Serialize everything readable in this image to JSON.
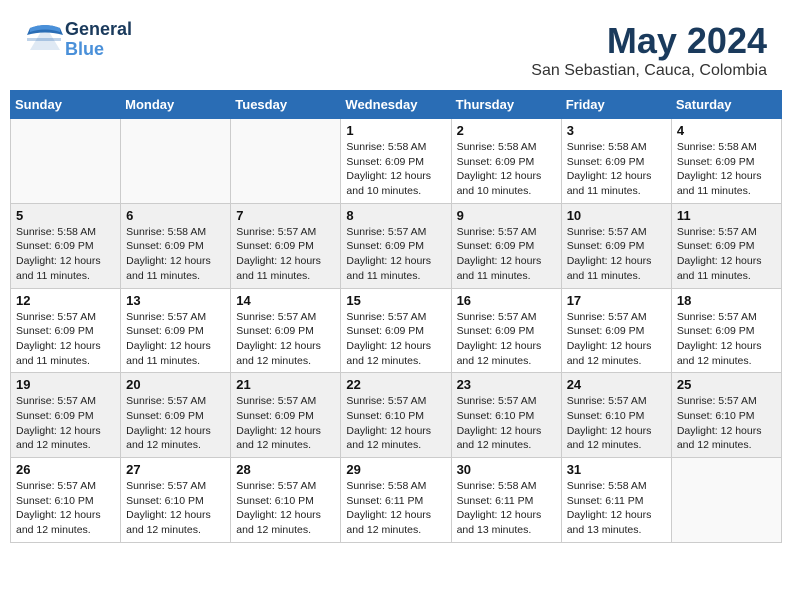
{
  "header": {
    "logo_line1": "General",
    "logo_line2": "Blue",
    "month_year": "May 2024",
    "location": "San Sebastian, Cauca, Colombia"
  },
  "days_of_week": [
    "Sunday",
    "Monday",
    "Tuesday",
    "Wednesday",
    "Thursday",
    "Friday",
    "Saturday"
  ],
  "weeks": [
    [
      {
        "day": "",
        "info": ""
      },
      {
        "day": "",
        "info": ""
      },
      {
        "day": "",
        "info": ""
      },
      {
        "day": "1",
        "info": "Sunrise: 5:58 AM\nSunset: 6:09 PM\nDaylight: 12 hours\nand 10 minutes."
      },
      {
        "day": "2",
        "info": "Sunrise: 5:58 AM\nSunset: 6:09 PM\nDaylight: 12 hours\nand 10 minutes."
      },
      {
        "day": "3",
        "info": "Sunrise: 5:58 AM\nSunset: 6:09 PM\nDaylight: 12 hours\nand 11 minutes."
      },
      {
        "day": "4",
        "info": "Sunrise: 5:58 AM\nSunset: 6:09 PM\nDaylight: 12 hours\nand 11 minutes."
      }
    ],
    [
      {
        "day": "5",
        "info": "Sunrise: 5:58 AM\nSunset: 6:09 PM\nDaylight: 12 hours\nand 11 minutes."
      },
      {
        "day": "6",
        "info": "Sunrise: 5:58 AM\nSunset: 6:09 PM\nDaylight: 12 hours\nand 11 minutes."
      },
      {
        "day": "7",
        "info": "Sunrise: 5:57 AM\nSunset: 6:09 PM\nDaylight: 12 hours\nand 11 minutes."
      },
      {
        "day": "8",
        "info": "Sunrise: 5:57 AM\nSunset: 6:09 PM\nDaylight: 12 hours\nand 11 minutes."
      },
      {
        "day": "9",
        "info": "Sunrise: 5:57 AM\nSunset: 6:09 PM\nDaylight: 12 hours\nand 11 minutes."
      },
      {
        "day": "10",
        "info": "Sunrise: 5:57 AM\nSunset: 6:09 PM\nDaylight: 12 hours\nand 11 minutes."
      },
      {
        "day": "11",
        "info": "Sunrise: 5:57 AM\nSunset: 6:09 PM\nDaylight: 12 hours\nand 11 minutes."
      }
    ],
    [
      {
        "day": "12",
        "info": "Sunrise: 5:57 AM\nSunset: 6:09 PM\nDaylight: 12 hours\nand 11 minutes."
      },
      {
        "day": "13",
        "info": "Sunrise: 5:57 AM\nSunset: 6:09 PM\nDaylight: 12 hours\nand 11 minutes."
      },
      {
        "day": "14",
        "info": "Sunrise: 5:57 AM\nSunset: 6:09 PM\nDaylight: 12 hours\nand 12 minutes."
      },
      {
        "day": "15",
        "info": "Sunrise: 5:57 AM\nSunset: 6:09 PM\nDaylight: 12 hours\nand 12 minutes."
      },
      {
        "day": "16",
        "info": "Sunrise: 5:57 AM\nSunset: 6:09 PM\nDaylight: 12 hours\nand 12 minutes."
      },
      {
        "day": "17",
        "info": "Sunrise: 5:57 AM\nSunset: 6:09 PM\nDaylight: 12 hours\nand 12 minutes."
      },
      {
        "day": "18",
        "info": "Sunrise: 5:57 AM\nSunset: 6:09 PM\nDaylight: 12 hours\nand 12 minutes."
      }
    ],
    [
      {
        "day": "19",
        "info": "Sunrise: 5:57 AM\nSunset: 6:09 PM\nDaylight: 12 hours\nand 12 minutes."
      },
      {
        "day": "20",
        "info": "Sunrise: 5:57 AM\nSunset: 6:09 PM\nDaylight: 12 hours\nand 12 minutes."
      },
      {
        "day": "21",
        "info": "Sunrise: 5:57 AM\nSunset: 6:09 PM\nDaylight: 12 hours\nand 12 minutes."
      },
      {
        "day": "22",
        "info": "Sunrise: 5:57 AM\nSunset: 6:10 PM\nDaylight: 12 hours\nand 12 minutes."
      },
      {
        "day": "23",
        "info": "Sunrise: 5:57 AM\nSunset: 6:10 PM\nDaylight: 12 hours\nand 12 minutes."
      },
      {
        "day": "24",
        "info": "Sunrise: 5:57 AM\nSunset: 6:10 PM\nDaylight: 12 hours\nand 12 minutes."
      },
      {
        "day": "25",
        "info": "Sunrise: 5:57 AM\nSunset: 6:10 PM\nDaylight: 12 hours\nand 12 minutes."
      }
    ],
    [
      {
        "day": "26",
        "info": "Sunrise: 5:57 AM\nSunset: 6:10 PM\nDaylight: 12 hours\nand 12 minutes."
      },
      {
        "day": "27",
        "info": "Sunrise: 5:57 AM\nSunset: 6:10 PM\nDaylight: 12 hours\nand 12 minutes."
      },
      {
        "day": "28",
        "info": "Sunrise: 5:57 AM\nSunset: 6:10 PM\nDaylight: 12 hours\nand 12 minutes."
      },
      {
        "day": "29",
        "info": "Sunrise: 5:58 AM\nSunset: 6:11 PM\nDaylight: 12 hours\nand 12 minutes."
      },
      {
        "day": "30",
        "info": "Sunrise: 5:58 AM\nSunset: 6:11 PM\nDaylight: 12 hours\nand 13 minutes."
      },
      {
        "day": "31",
        "info": "Sunrise: 5:58 AM\nSunset: 6:11 PM\nDaylight: 12 hours\nand 13 minutes."
      },
      {
        "day": "",
        "info": ""
      }
    ]
  ]
}
